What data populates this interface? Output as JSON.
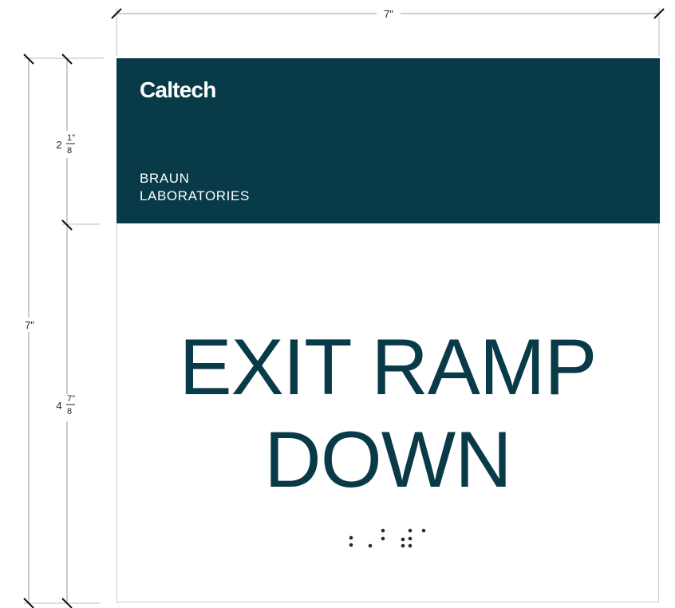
{
  "dimensions": {
    "top_width": "7\"",
    "total_height": "7\"",
    "header_height": {
      "whole": "2",
      "numerator": "1\"",
      "denominator": "8"
    },
    "body_height": {
      "whole": "4",
      "numerator": "7\"",
      "denominator": "8"
    }
  },
  "sign": {
    "brand": "Caltech",
    "building_line1": "BRAUN",
    "building_line2": "LABORATORIES",
    "message_line1": "EXIT RAMP",
    "message_line2": "DOWN",
    "braille": "⠅⠄⠐⠠⠕⠵"
  },
  "colors": {
    "header_background": "#083a48",
    "message_text": "#083a48",
    "dimension_lines": "#9a9a9a",
    "braille_dots": "#2a2a2a"
  }
}
